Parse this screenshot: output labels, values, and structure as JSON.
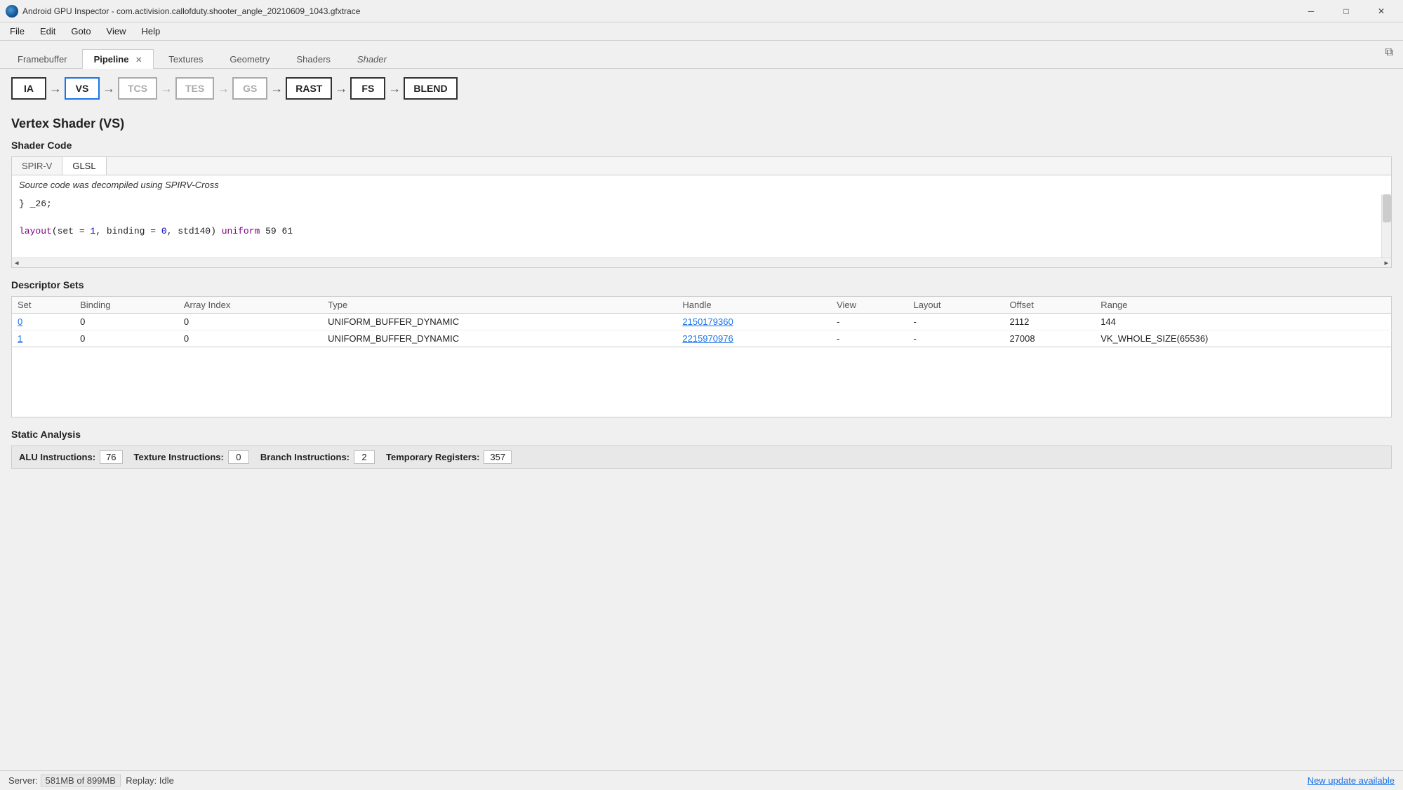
{
  "titlebar": {
    "icon": "android-gpu-inspector-icon",
    "text": "Android GPU Inspector - com.activision.callofduty.shooter_angle_20210609_1043.gfxtrace",
    "minimize": "─",
    "maximize": "□",
    "close": "✕"
  },
  "menubar": {
    "items": [
      "File",
      "Edit",
      "Goto",
      "View",
      "Help"
    ]
  },
  "tabs": [
    {
      "id": "framebuffer",
      "label": "Framebuffer",
      "active": false,
      "closable": false,
      "italic": false
    },
    {
      "id": "pipeline",
      "label": "Pipeline",
      "active": true,
      "closable": true,
      "italic": false
    },
    {
      "id": "textures",
      "label": "Textures",
      "active": false,
      "closable": false,
      "italic": false
    },
    {
      "id": "geometry",
      "label": "Geometry",
      "active": false,
      "closable": false,
      "italic": false
    },
    {
      "id": "shaders",
      "label": "Shaders",
      "active": false,
      "closable": false,
      "italic": false
    },
    {
      "id": "shader",
      "label": "Shader",
      "active": false,
      "closable": false,
      "italic": true
    }
  ],
  "pipeline": {
    "nodes": [
      {
        "id": "IA",
        "label": "IA",
        "state": "normal"
      },
      {
        "id": "VS",
        "label": "VS",
        "state": "active"
      },
      {
        "id": "TCS",
        "label": "TCS",
        "state": "inactive"
      },
      {
        "id": "TES",
        "label": "TES",
        "state": "inactive"
      },
      {
        "id": "GS",
        "label": "GS",
        "state": "inactive"
      },
      {
        "id": "RAST",
        "label": "RAST",
        "state": "normal"
      },
      {
        "id": "FS",
        "label": "FS",
        "state": "normal"
      },
      {
        "id": "BLEND",
        "label": "BLEND",
        "state": "normal"
      }
    ]
  },
  "section": {
    "title": "Vertex Shader (VS)",
    "shader_code": {
      "label": "Shader Code",
      "tabs": [
        "SPIR-V",
        "GLSL"
      ],
      "active_tab": "GLSL",
      "info": "Source code was decompiled using SPIRV-Cross",
      "code_lines": [
        "} _26;",
        "",
        "layout(set = 1, binding = 0, std140) uniform 59 61"
      ]
    },
    "descriptor_sets": {
      "label": "Descriptor Sets",
      "columns": [
        "Set",
        "Binding",
        "Array Index",
        "Type",
        "Handle",
        "View",
        "Layout",
        "Offset",
        "Range"
      ],
      "rows": [
        {
          "set": "0",
          "binding": "0",
          "array_index": "0",
          "type": "UNIFORM_BUFFER_DYNAMIC",
          "handle": "2150179360",
          "view": "-",
          "layout": "-",
          "offset": "2112",
          "range": "144"
        },
        {
          "set": "1",
          "binding": "0",
          "array_index": "0",
          "type": "UNIFORM_BUFFER_DYNAMIC",
          "handle": "2215970976",
          "view": "-",
          "layout": "-",
          "offset": "27008",
          "range": "VK_WHOLE_SIZE(65536)"
        }
      ]
    },
    "static_analysis": {
      "label": "Static Analysis",
      "stats": [
        {
          "label": "ALU Instructions:",
          "value": "76"
        },
        {
          "label": "Texture Instructions:",
          "value": "0"
        },
        {
          "label": "Branch Instructions:",
          "value": "2"
        },
        {
          "label": "Temporary Registers:",
          "value": "357"
        }
      ]
    }
  },
  "statusbar": {
    "server_label": "Server:",
    "server_value": "581MB of 899MB",
    "replay_label": "Replay:",
    "replay_value": "Idle",
    "update_link": "New update available"
  }
}
